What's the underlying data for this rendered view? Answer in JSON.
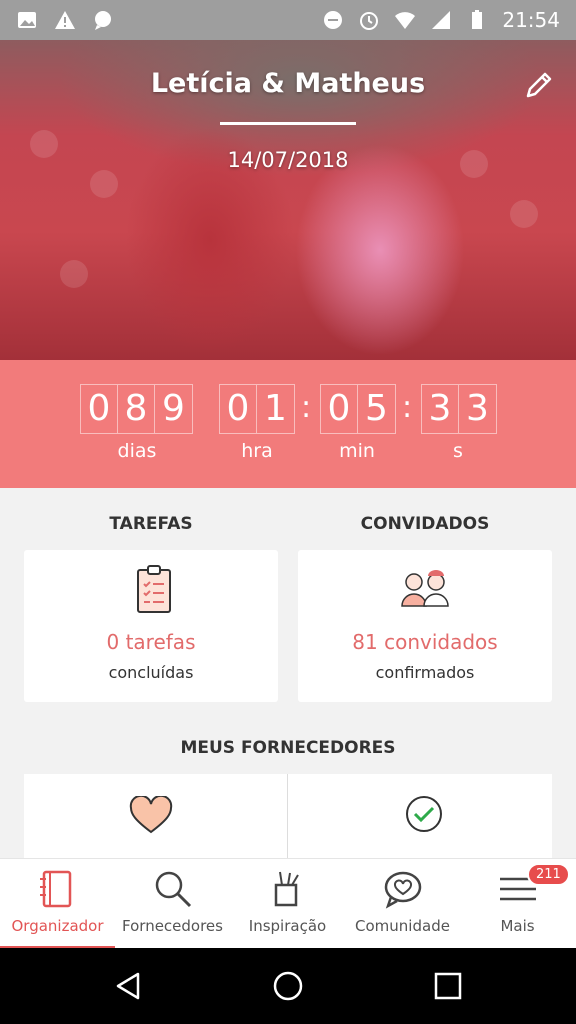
{
  "statusbar": {
    "time": "21:54"
  },
  "hero": {
    "title": "Letícia & Matheus",
    "date": "14/07/2018"
  },
  "countdown": {
    "days": [
      "0",
      "8",
      "9"
    ],
    "hours": [
      "0",
      "1"
    ],
    "minutes": [
      "0",
      "5"
    ],
    "seconds": [
      "3",
      "3"
    ],
    "days_label": "dias",
    "hours_label": "hra",
    "minutes_label": "min",
    "seconds_label": "s",
    "separator": ":"
  },
  "tasks": {
    "title": "TAREFAS",
    "count_text": "0 tarefas",
    "sub_text": "concluídas"
  },
  "guests": {
    "title": "CONVIDADOS",
    "count_text": "81 convidados",
    "sub_text": "confirmados"
  },
  "suppliers": {
    "title": "MEUS FORNECEDORES"
  },
  "tabs": [
    {
      "label": "Organizador",
      "icon": "notebook-icon"
    },
    {
      "label": "Fornecedores",
      "icon": "search-icon"
    },
    {
      "label": "Inspiração",
      "icon": "pencil-cup-icon"
    },
    {
      "label": "Comunidade",
      "icon": "chat-heart-icon"
    },
    {
      "label": "Mais",
      "icon": "menu-icon"
    }
  ],
  "more_badge": "211",
  "colors": {
    "accent": "#f27b7b",
    "active_tab": "#e25555",
    "stat_text": "#e26b6b"
  }
}
